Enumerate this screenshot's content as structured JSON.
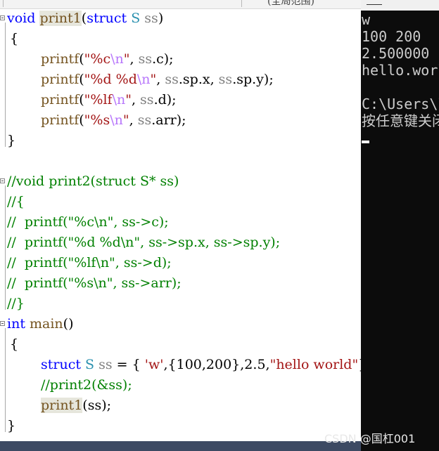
{
  "editor": {
    "tab_title": "(全局范围)",
    "lines": {
      "l1": [
        "void",
        " ",
        "print1",
        "(",
        "struct",
        " ",
        "S",
        " ",
        "ss",
        ")"
      ],
      "l2": "{",
      "l3": [
        "printf",
        "(",
        "\"%c",
        "\\n",
        "\"",
        ", ",
        "ss",
        ".c);"
      ],
      "l4": [
        "printf",
        "(",
        "\"%d %d",
        "\\n",
        "\"",
        ", ",
        "ss",
        ".sp.x, ",
        "ss",
        ".sp.y);"
      ],
      "l5": [
        "printf",
        "(",
        "\"%lf",
        "\\n",
        "\"",
        ", ",
        "ss",
        ".d);"
      ],
      "l6": [
        "printf",
        "(",
        "\"%s",
        "\\n",
        "\"",
        ", ",
        "ss",
        ".arr);"
      ],
      "l7": "}",
      "l9": "//void print2(struct S* ss)",
      "l10": "//{",
      "l11": "//  printf(\"%c\\n\", ss->c);",
      "l12": "//  printf(\"%d %d\\n\", ss->sp.x, ss->sp.y);",
      "l13": "//  printf(\"%lf\\n\", ss->d);",
      "l14": "//  printf(\"%s\\n\", ss->arr);",
      "l15": "//}",
      "l16": [
        "int",
        " ",
        "main",
        "()"
      ],
      "l17": "{",
      "l18": [
        "struct",
        " ",
        "S",
        " ",
        "ss",
        " = { ",
        "'w'",
        ",{100,200},2.5,",
        "\"hello world\"",
        "};"
      ],
      "l19": "//print2(&ss);",
      "l20": [
        "print1",
        "(ss);"
      ],
      "l21": "}"
    }
  },
  "console": {
    "lines": [
      "w",
      "100 200",
      "2.500000",
      "hello.world",
      "",
      "C:\\Users\\lenovo",
      "按任意键关闭此窗口"
    ]
  },
  "watermark": "CSDN @国杠001",
  "colors": {
    "keyword": "#0000ff",
    "function": "#74531f",
    "type": "#2b91af",
    "parameter": "#808080",
    "string": "#a31515",
    "escape": "#b776fb",
    "comment": "#008000",
    "console_bg": "#0c0c0c",
    "console_text": "#cccccc"
  }
}
